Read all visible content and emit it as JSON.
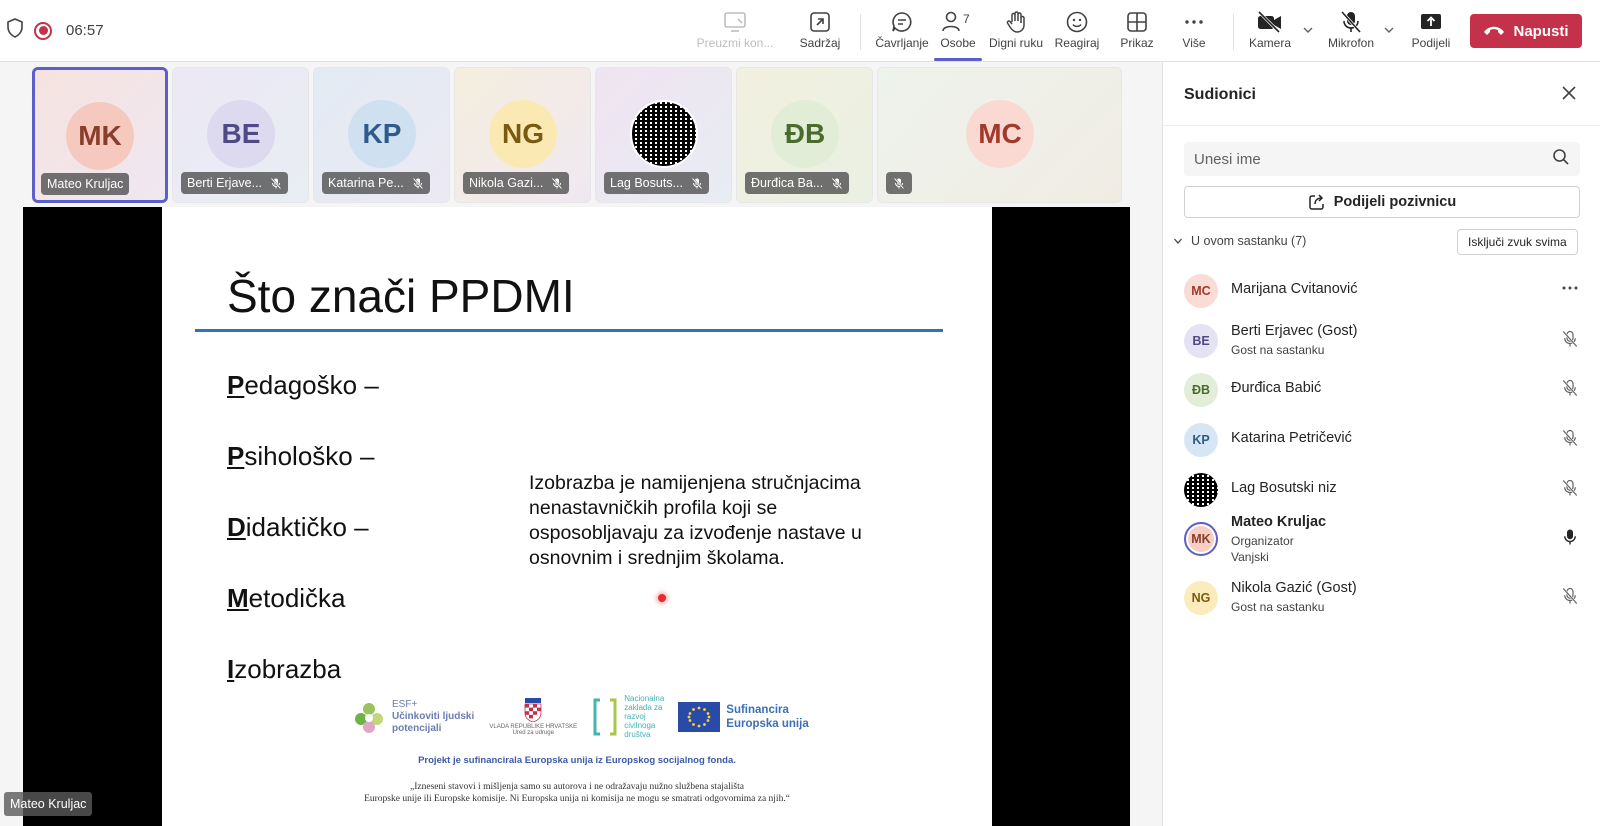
{
  "topbar": {
    "timer": "06:57",
    "buttons": [
      {
        "label": "Preuzmi kon..."
      },
      {
        "label": "Sadržaj"
      },
      {
        "label": "Čavrljanje"
      },
      {
        "label": "Osobe",
        "count": "7"
      },
      {
        "label": "Digni ruku"
      },
      {
        "label": "Reagiraj"
      },
      {
        "label": "Prikaz"
      },
      {
        "label": "Više"
      },
      {
        "label": "Kamera"
      },
      {
        "label": "Mikrofon"
      },
      {
        "label": "Podijeli"
      }
    ],
    "leave_label": "Napusti",
    "accent": "#5b5fc7",
    "leave_color": "#c4314b"
  },
  "tiles": [
    {
      "initials": "MK",
      "name": "Mateo Kruljac",
      "bg": "#f3dcd8",
      "avatar_bg": "#f5c9bd",
      "color": "#8a3d2b"
    },
    {
      "initials": "BE",
      "name": "Berti Erjave...",
      "bg": "#e7e5f1",
      "avatar_bg": "#ddd9ef",
      "color": "#4f4a86"
    },
    {
      "initials": "KP",
      "name": "Katarina Pe...",
      "bg": "#e3eaf1",
      "avatar_bg": "#cfe0f1",
      "color": "#2e5a8c"
    },
    {
      "initials": "NG",
      "name": "Nikola Gazi...",
      "bg": "#f3ecdd",
      "avatar_bg": "#fbe9b4",
      "color": "#7a5a10"
    },
    {
      "initials": "",
      "name": "Lag Bosuts...",
      "bg": "#ece6ef",
      "avatar_bg": "#ffffff",
      "color": "#000000"
    },
    {
      "initials": "ĐB",
      "name": "Đurđica Ba...",
      "bg": "#eef0e3",
      "avatar_bg": "#e2edd8",
      "color": "#4b6b2d"
    },
    {
      "initials": "MC",
      "name": "",
      "bg": "#eef2ec",
      "avatar_bg": "#fad9d3",
      "color": "#a13a2b"
    }
  ],
  "slide": {
    "title": "Što znači PPDMI",
    "acronym": [
      {
        "letter": "P",
        "rest": "edagoško –"
      },
      {
        "letter": "P",
        "rest": "sihološko –"
      },
      {
        "letter": "D",
        "rest": "idaktičko –"
      },
      {
        "letter": "M",
        "rest": "etodička"
      },
      {
        "letter": "I",
        "rest": "zobrazba"
      }
    ],
    "description": "Izobrazba je namijenjena stručnjacima nenastavničkih profila koji se osposobljavaju za izvođenje nastave u osnovnim i srednjim školama.",
    "logo_esf": [
      "ESF+",
      "Učinkoviti ljudski",
      "potencijali"
    ],
    "logo_hr": [
      "VLADA REPUBLIKE HRVATSKE",
      "Ured za udruge"
    ],
    "logo_nz": [
      "Nacionalna",
      "zaklada za",
      "razvoj",
      "civilnoga",
      "društva"
    ],
    "logo_eu": [
      "Sufinancira",
      "Europska unija"
    ],
    "footer1": "Projekt je sufinancirala Europska unija iz Europskog socijalnog fonda.",
    "footer2a": "„Izneseni stavovi i mišljenja samo su autorova i ne odražavaju nužno službena stajališta",
    "footer2b": "Europske unije ili Europske komisije. Ni Europska unija ni komisija ne mogu se smatrati odgovornima za njih.“"
  },
  "presenter": "Mateo Kruljac",
  "panel": {
    "title": "Sudionici",
    "search_placeholder": "Unesi ime",
    "invite_label": "Podijeli pozivnicu",
    "section_label": "U ovom sastanku (7)",
    "mute_all_label": "Isključi zvuk svima",
    "people": [
      {
        "initials": "MC",
        "name": "Marijana Cvitanović",
        "role": "",
        "role2": "",
        "bg": "#fadcd6",
        "color": "#a13a2b",
        "right": "more"
      },
      {
        "initials": "BE",
        "name": "Berti Erjavec (Gost)",
        "role": "Gost na sastanku",
        "role2": "",
        "bg": "#e5e2f3",
        "color": "#4f4a86",
        "right": "mic-off"
      },
      {
        "initials": "ĐB",
        "name": "Đurđica Babić",
        "role": "",
        "role2": "",
        "bg": "#e3eed9",
        "color": "#4b6b2d",
        "right": "mic-off"
      },
      {
        "initials": "KP",
        "name": "Katarina Petričević",
        "role": "",
        "role2": "",
        "bg": "#d7e6f4",
        "color": "#2e5a8c",
        "right": "mic-off"
      },
      {
        "initials": "",
        "name": "Lag Bosutski niz",
        "role": "",
        "role2": "",
        "bg": "#ffffff",
        "color": "#000000",
        "right": "mic-off"
      },
      {
        "initials": "MK",
        "name": "Mateo Kruljac",
        "role": "Organizator",
        "role2": "Vanjski",
        "bg": "#f5cfc4",
        "color": "#8a3d2b",
        "right": "mic-on"
      },
      {
        "initials": "NG",
        "name": "Nikola Gazić (Gost)",
        "role": "Gost na sastanku",
        "role2": "",
        "bg": "#fbecbd",
        "color": "#7a5a10",
        "right": "mic-off"
      }
    ]
  }
}
